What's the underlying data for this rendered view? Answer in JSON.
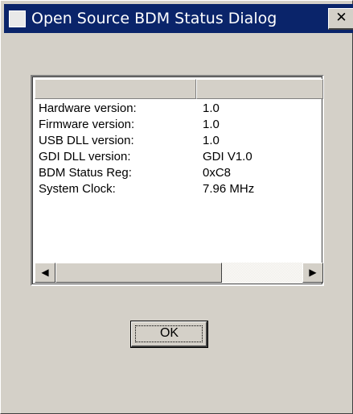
{
  "window": {
    "title": "Open Source BDM Status Dialog",
    "close_glyph": "✕",
    "icon": "app-icon"
  },
  "listview": {
    "columns": [
      "",
      ""
    ],
    "rows": [
      {
        "name": "Hardware version:",
        "value": "1.0"
      },
      {
        "name": "Firmware version:",
        "value": "1.0"
      },
      {
        "name": "USB DLL version:",
        "value": "1.0"
      },
      {
        "name": "GDI DLL version:",
        "value": "GDI V1.0"
      },
      {
        "name": "BDM Status Reg:",
        "value": "0xC8"
      },
      {
        "name": "System Clock:",
        "value": "7.96 MHz"
      }
    ],
    "scrollbar": {
      "left_glyph": "◀",
      "right_glyph": "▶"
    }
  },
  "buttons": {
    "ok_label": "OK"
  },
  "colors": {
    "face": "#d4d0c8",
    "titlebar": "#0a246a",
    "list_bg": "#ffffff"
  }
}
